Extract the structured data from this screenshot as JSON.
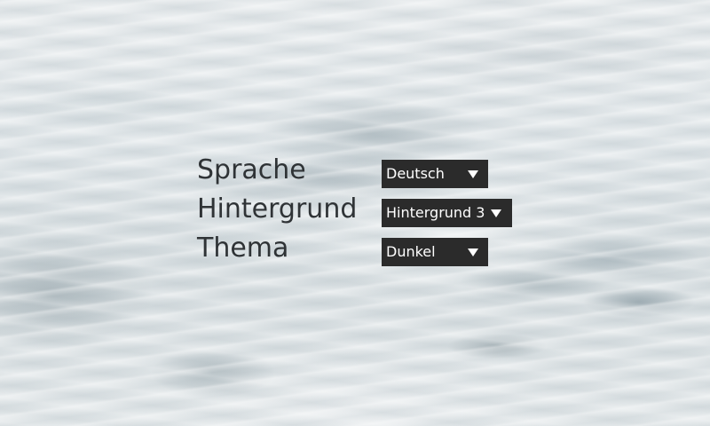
{
  "settings": {
    "language": {
      "label": "Sprache",
      "value": "Deutsch",
      "icon": "chevron-down-icon"
    },
    "background": {
      "label": "Hintergrund",
      "value": "Hintergrund 3",
      "icon": "chevron-down-icon"
    },
    "theme": {
      "label": "Thema",
      "value": "Dunkel",
      "icon": "chevron-down-icon"
    }
  },
  "colors": {
    "dropdown_bg": "#2b2b2b",
    "dropdown_text": "#ffffff",
    "label_text": "#2f3336"
  }
}
